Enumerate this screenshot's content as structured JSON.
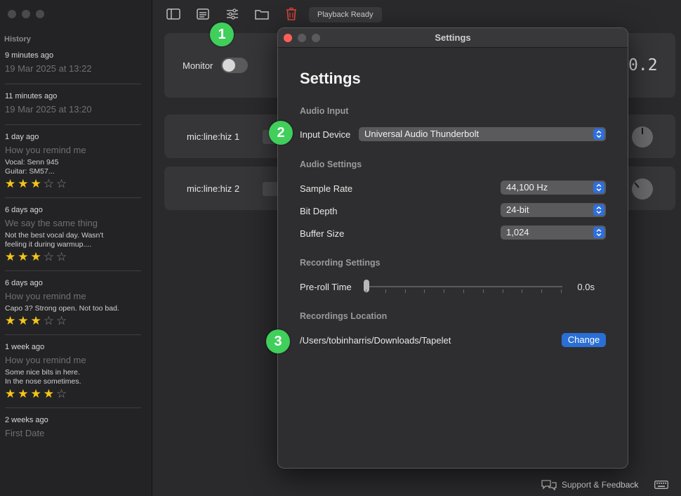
{
  "sidebar": {
    "title": "History",
    "items": [
      {
        "when": "9 minutes ago",
        "name": "19 Mar 2025 at 13:22",
        "note": "",
        "rating": null
      },
      {
        "when": "11 minutes ago",
        "name": "19 Mar 2025 at 13:20",
        "note": "",
        "rating": null
      },
      {
        "when": "1 day ago",
        "name": "How you remind me",
        "note": "Vocal: Senn 945\nGuitar: SM57...",
        "rating": 3
      },
      {
        "when": "6 days ago",
        "name": "We say the same thing",
        "note": "Not the best vocal day. Wasn't\nfeeling it during warmup....",
        "rating": 3
      },
      {
        "when": "6 days ago",
        "name": "How you remind me",
        "note": "Capo 3? Strong open. Not too bad.",
        "rating": 3
      },
      {
        "when": "1 week ago",
        "name": "How you remind me",
        "note": "Some nice bits in here.\nIn the nose sometimes.",
        "rating": 4
      },
      {
        "when": "2 weeks ago",
        "name": "First Date",
        "note": "",
        "rating": null
      }
    ]
  },
  "toolbar": {
    "status": "Playback Ready",
    "icons": [
      "sidebar-icon",
      "notes-icon",
      "sliders-icon",
      "folder-icon",
      "trash-icon"
    ],
    "trash_color": "#e0443a"
  },
  "main": {
    "monitor_label": "Monitor",
    "timer_fragment": "0.2",
    "tracks": [
      {
        "name": "mic:line:hiz 1"
      },
      {
        "name": "mic:line:hiz 2"
      }
    ],
    "footer_link": "Support & Feedback"
  },
  "badges": {
    "one": "1",
    "two": "2",
    "three": "3"
  },
  "settings": {
    "window_title": "Settings",
    "heading": "Settings",
    "audio_input": {
      "section": "Audio Input",
      "device_label": "Input Device",
      "device_value": "Universal Audio Thunderbolt"
    },
    "audio_settings": {
      "section": "Audio Settings",
      "sample_rate_label": "Sample Rate",
      "sample_rate_value": "44,100 Hz",
      "bit_depth_label": "Bit Depth",
      "bit_depth_value": "24-bit",
      "buffer_size_label": "Buffer Size",
      "buffer_size_value": "1,024"
    },
    "recording_settings": {
      "section": "Recording Settings",
      "preroll_label": "Pre-roll Time",
      "preroll_value": "0.0s",
      "preroll_fraction": 0
    },
    "location": {
      "section": "Recordings Location",
      "path": "/Users/tobinharris/Downloads/Tapelet",
      "change_label": "Change"
    },
    "accent_color": "#2a6fd6"
  }
}
